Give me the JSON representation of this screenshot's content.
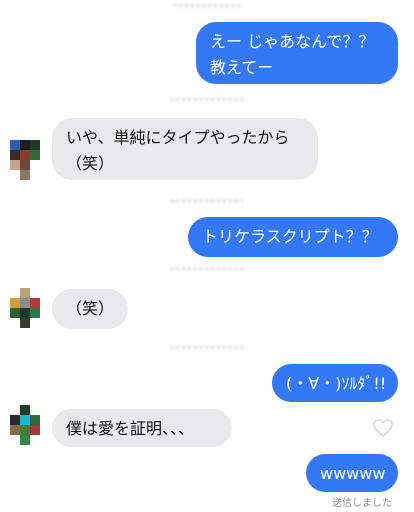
{
  "thread": {
    "messages": [
      {
        "direction": "outgoing",
        "lines": [
          "えー じゃあなんで？？",
          "教えてー"
        ]
      },
      {
        "direction": "incoming",
        "lines": [
          "いや、単純にタイプやったから",
          "（笑）"
        ]
      },
      {
        "direction": "outgoing",
        "lines": [
          "トリケラスクリプト？？"
        ]
      },
      {
        "direction": "incoming",
        "lines": [
          "（笑）"
        ]
      },
      {
        "direction": "outgoing",
        "lines": [
          "(・∀・)ｿﾙﾀﾞ!!"
        ]
      },
      {
        "direction": "incoming",
        "lines": [
          "僕は愛を証明、、、"
        ]
      },
      {
        "direction": "outgoing",
        "lines": [
          "wwwww"
        ]
      }
    ],
    "delivery_status": "送信しました"
  },
  "icons": {
    "heart": "heart-outline-icon",
    "avatar": "pixelated-avatar"
  },
  "colors": {
    "outgoing_bubble": "#3478f6",
    "incoming_bubble": "#e9e9eb",
    "background": "#ffffff"
  }
}
